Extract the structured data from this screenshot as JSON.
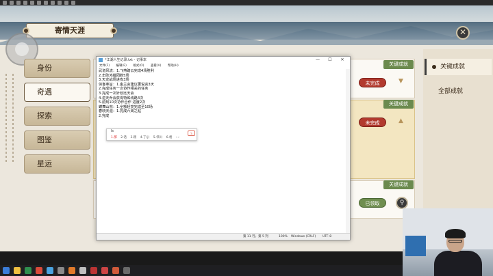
{
  "game": {
    "title": "寄情天涯",
    "close_glyph": "✕",
    "side_tabs": [
      "身份",
      "奇遇",
      "探索",
      "图鉴",
      "星运"
    ],
    "active_side_tab": 1,
    "cards": [
      {
        "badge": "关键成就",
        "status": "未完成"
      },
      {
        "badge": "关键成就",
        "status": "未完成"
      },
      {
        "badge": "关键成就",
        "status": "已领取"
      }
    ],
    "right_tabs": [
      "关键成就",
      "全部成就"
    ],
    "active_right_tab": 0
  },
  "notepad": {
    "title": "*江湖人生记录.txt - 记事本",
    "controls": [
      "—",
      "☐",
      "✕"
    ],
    "menu": [
      "文件(F)",
      "编辑(E)",
      "格式(O)",
      "查看(V)",
      "帮助(H)"
    ],
    "lines": [
      "武道风流：1.飞燕踏云完成4场胜利",
      "2.击败鸿猎团数5场",
      "3.天龙战场进攻3场",
      "侠客奉旨：1.金兰会建议更说完3天",
      "2.完成任务一次协作相关的任务",
      "3.完成一次针划比天会",
      "4.进天乔会获得特殊线路4次",
      "5.前刻10次协作合作 进度2次",
      "蝶舞山林：1.全额轻突完成至10场",
      "春晓天涯：1.完成六周之贴",
      "2.完成"
    ],
    "status": [
      "第 11 行，第 5 列",
      "100%",
      "Windows (CRLF)",
      "UTF-8"
    ]
  },
  "ime": {
    "composition": "ls",
    "candidates": [
      "1.那",
      "2.话",
      "3.刚",
      "4.了(j)",
      "5.邻(l)",
      "6.格"
    ],
    "selected": 0,
    "nav": "‹ ›"
  }
}
